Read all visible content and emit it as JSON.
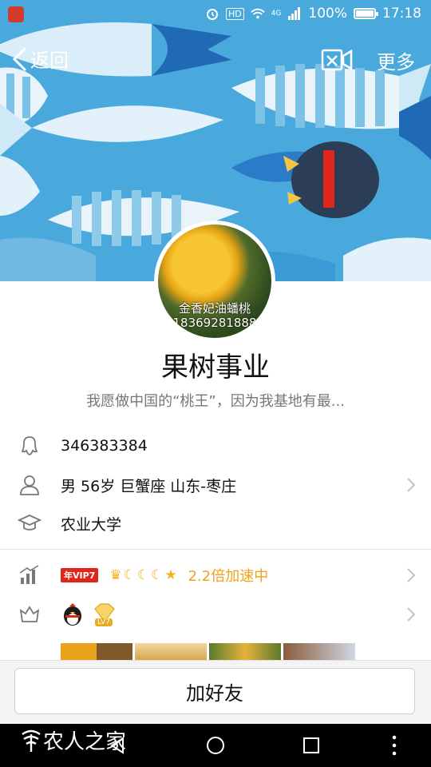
{
  "status_bar": {
    "battery_text": "100%",
    "battery_level": 1.0,
    "time": "17:18",
    "network_label": "4G",
    "hd_label": "HD"
  },
  "nav": {
    "back_label": "返回",
    "more_label": "更多"
  },
  "profile": {
    "avatar_watermark_line1": "金香妃油蟠桃",
    "avatar_watermark_line2": "18369281888",
    "nickname": "果树事业",
    "signature": "我愿做中国的“桃王”，因为我基地有最..."
  },
  "info": {
    "qq_number": "346383384",
    "personal": "男  56岁  巨蟹座  山东-枣庄",
    "school": "农业大学"
  },
  "vip": {
    "badge": "年VIP7",
    "level_icons": [
      "crown-icon",
      "moon-icon",
      "moon-icon",
      "moon-icon",
      "star-icon"
    ],
    "speed_text": "2.2倍加速中"
  },
  "medals": {
    "icons": [
      "qq-penguin-icon",
      "diamond-medal-icon"
    ],
    "diamond_label": "LV7"
  },
  "actions": {
    "add_friend_label": "加好友"
  },
  "watermark": {
    "text": "农人之家"
  },
  "colors": {
    "banner_bg": "#4aa9dc",
    "vip_red": "#e0261b",
    "speed_orange": "#f0a21b"
  }
}
